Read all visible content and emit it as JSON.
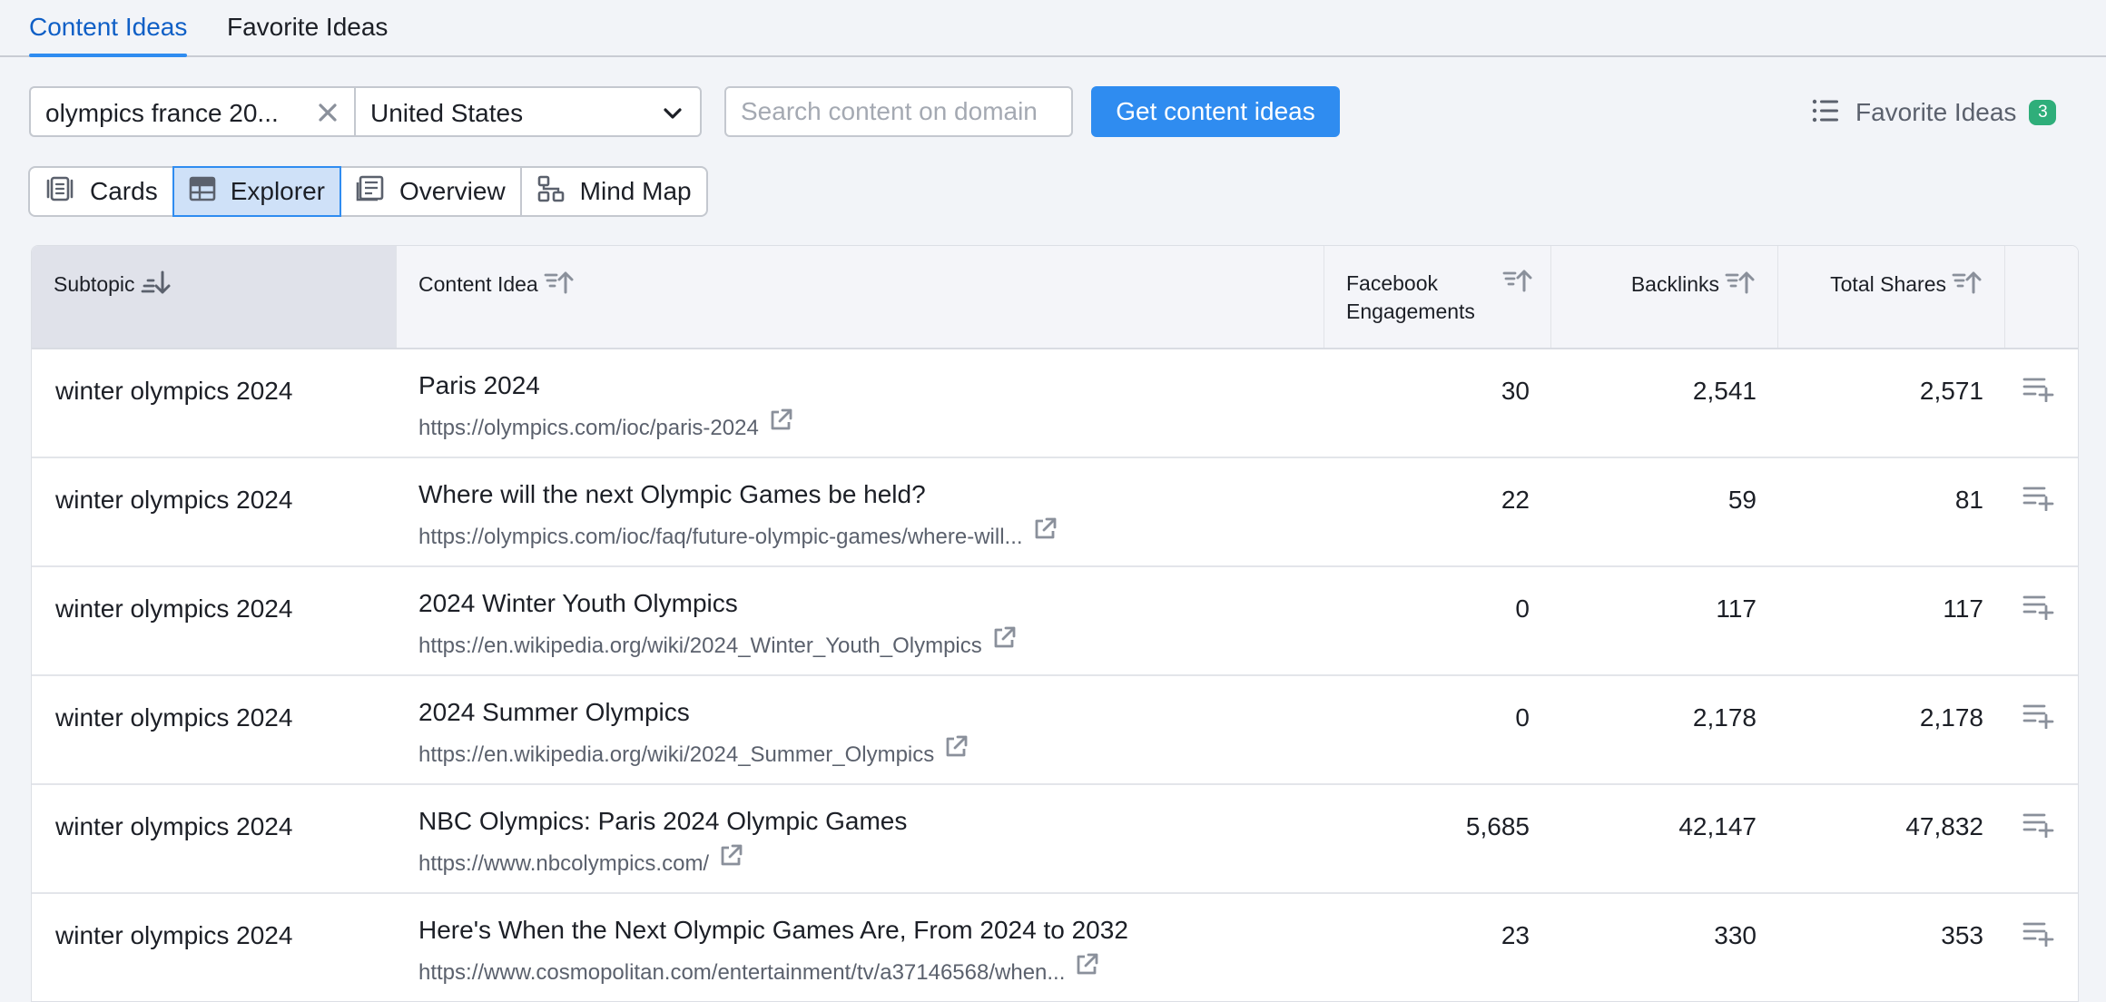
{
  "top_tabs": [
    {
      "label": "Content Ideas",
      "active": true
    },
    {
      "label": "Favorite Ideas",
      "active": false
    }
  ],
  "search": {
    "keyword": "olympics france 20...",
    "country": "United States",
    "domain_placeholder": "Search content on domain",
    "submit_label": "Get content ideas"
  },
  "favorites": {
    "label": "Favorite Ideas",
    "count": "3"
  },
  "views": [
    {
      "label": "Cards",
      "icon": "cards-icon",
      "active": false
    },
    {
      "label": "Explorer",
      "icon": "table-icon",
      "active": true
    },
    {
      "label": "Overview",
      "icon": "overview-icon",
      "active": false
    },
    {
      "label": "Mind Map",
      "icon": "mind-map-icon",
      "active": false
    }
  ],
  "table": {
    "columns": {
      "subtopic": "Subtopic",
      "content_idea": "Content Idea",
      "facebook_line1": "Facebook",
      "facebook_line2": "Engagements",
      "backlinks": "Backlinks",
      "total_shares": "Total Shares"
    },
    "rows": [
      {
        "subtopic": "winter olympics 2024",
        "title": "Paris 2024",
        "url": "https://olympics.com/ioc/paris-2024",
        "facebook": "30",
        "backlinks": "2,541",
        "shares": "2,571"
      },
      {
        "subtopic": "winter olympics 2024",
        "title": "Where will the next Olympic Games be held?",
        "url": "https://olympics.com/ioc/faq/future-olympic-games/where-will...",
        "facebook": "22",
        "backlinks": "59",
        "shares": "81"
      },
      {
        "subtopic": "winter olympics 2024",
        "title": "2024 Winter Youth Olympics",
        "url": "https://en.wikipedia.org/wiki/2024_Winter_Youth_Olympics",
        "facebook": "0",
        "backlinks": "117",
        "shares": "117"
      },
      {
        "subtopic": "winter olympics 2024",
        "title": "2024 Summer Olympics",
        "url": "https://en.wikipedia.org/wiki/2024_Summer_Olympics",
        "facebook": "0",
        "backlinks": "2,178",
        "shares": "2,178"
      },
      {
        "subtopic": "winter olympics 2024",
        "title": "NBC Olympics: Paris 2024 Olympic Games",
        "url": "https://www.nbcolympics.com/",
        "facebook": "5,685",
        "backlinks": "42,147",
        "shares": "47,832"
      },
      {
        "subtopic": "winter olympics 2024",
        "title": "Here's When the Next Olympic Games Are, From 2024 to 2032",
        "url": "https://www.cosmopolitan.com/entertainment/tv/a37146568/when...",
        "facebook": "23",
        "backlinks": "330",
        "shares": "353"
      }
    ]
  },
  "colors": {
    "accent": "#2f8cf0",
    "active_tab_text": "#0f5fc6",
    "badge": "#2fae7a",
    "background": "#f2f4f8"
  }
}
